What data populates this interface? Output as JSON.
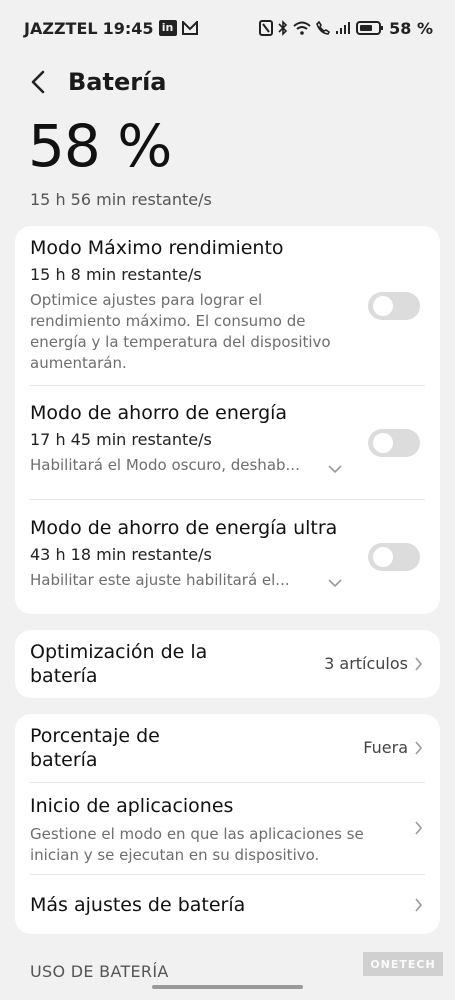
{
  "status_bar": {
    "carrier": "JAZZTEL",
    "time": "19:45",
    "battery_pct": "58 %"
  },
  "header": {
    "title": "Batería"
  },
  "battery": {
    "percentage": "58 %",
    "remaining": "15 h 56 min restante/s"
  },
  "modes": [
    {
      "title": "Modo Máximo rendimiento",
      "remaining": "15 h 8 min restante/s",
      "description": "Optimice ajustes para lograr el rendimiento máximo. El consumo de energía y la temperatura del dispositivo aumentarán.",
      "enabled": false
    },
    {
      "title": "Modo de ahorro de energía",
      "remaining": "17 h 45 min restante/s",
      "description": "Habilitará el Modo oscuro, deshab...",
      "enabled": false
    },
    {
      "title": "Modo de ahorro de energía ultra",
      "remaining": "43 h 18 min restante/s",
      "description": "Habilitar este ajuste habilitará el...",
      "enabled": false
    }
  ],
  "optimization": {
    "title": "Optimización de la batería",
    "value": "3 artículos"
  },
  "settings": {
    "percentage_title": "Porcentaje de batería",
    "percentage_value": "Fuera",
    "app_launch_title": "Inicio de aplicaciones",
    "app_launch_desc": "Gestione el modo en que las aplicaciones se inician y se ejecutan en su dispositivo.",
    "more_title": "Más ajustes de batería"
  },
  "usage_section": "USO DE BATERÍA",
  "watermark": "ONETECH",
  "colors": {
    "background": "#f1f1f1",
    "card": "#ffffff",
    "toggle_off": "#dcdcdc"
  }
}
